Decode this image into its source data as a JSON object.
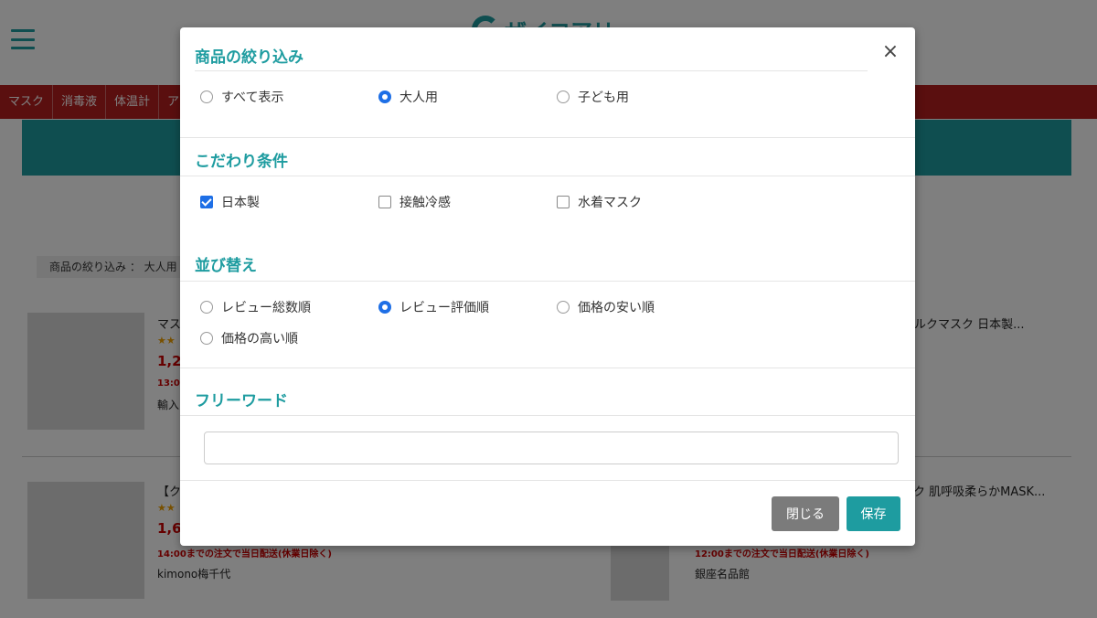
{
  "header": {
    "logo_text": "ザイコアリ"
  },
  "nav": {
    "items": [
      "マスク",
      "消毒液",
      "体温計",
      "ア"
    ]
  },
  "filter_summary": "商品の絞り込み ： 大人用",
  "products": [
    {
      "title": "マス",
      "stars": "★★",
      "price": "1,2",
      "delivery": "13:0",
      "shop": "輸入"
    },
    {
      "title": "ルクマスク 日本製..."
    },
    {
      "title": "【ク",
      "stars": "★★",
      "price": "1,6",
      "delivery": "14:00までの注文で当日配送(休業日除く)",
      "shop": "kimono梅千代"
    },
    {
      "title": "スク 肌呼吸柔らかMASK...",
      "delivery": "12:00までの注文で当日配送(休業日除く)",
      "shop": "銀座名品館"
    }
  ],
  "modal": {
    "title": "商品の絞り込み",
    "close_label": "×",
    "target": {
      "options": [
        {
          "label": "すべて表示",
          "selected": false
        },
        {
          "label": "大人用",
          "selected": true
        },
        {
          "label": "子ども用",
          "selected": false
        }
      ]
    },
    "conditions": {
      "heading": "こだわり条件",
      "options": [
        {
          "label": "日本製",
          "checked": true
        },
        {
          "label": "接触冷感",
          "checked": false
        },
        {
          "label": "水着マスク",
          "checked": false
        }
      ]
    },
    "sort": {
      "heading": "並び替え",
      "options": [
        {
          "label": "レビュー総数順",
          "selected": false
        },
        {
          "label": "レビュー評価順",
          "selected": true
        },
        {
          "label": "価格の安い順",
          "selected": false
        },
        {
          "label": "価格の高い順",
          "selected": false
        }
      ]
    },
    "freeword": {
      "heading": "フリーワード",
      "value": "",
      "placeholder": ""
    },
    "buttons": {
      "close": "閉じる",
      "save": "保存"
    }
  },
  "colors": {
    "accent": "#1e9ca0",
    "nav": "#b51f1f",
    "selected": "#1e6fe6",
    "close_button": "#7b7b7b"
  }
}
